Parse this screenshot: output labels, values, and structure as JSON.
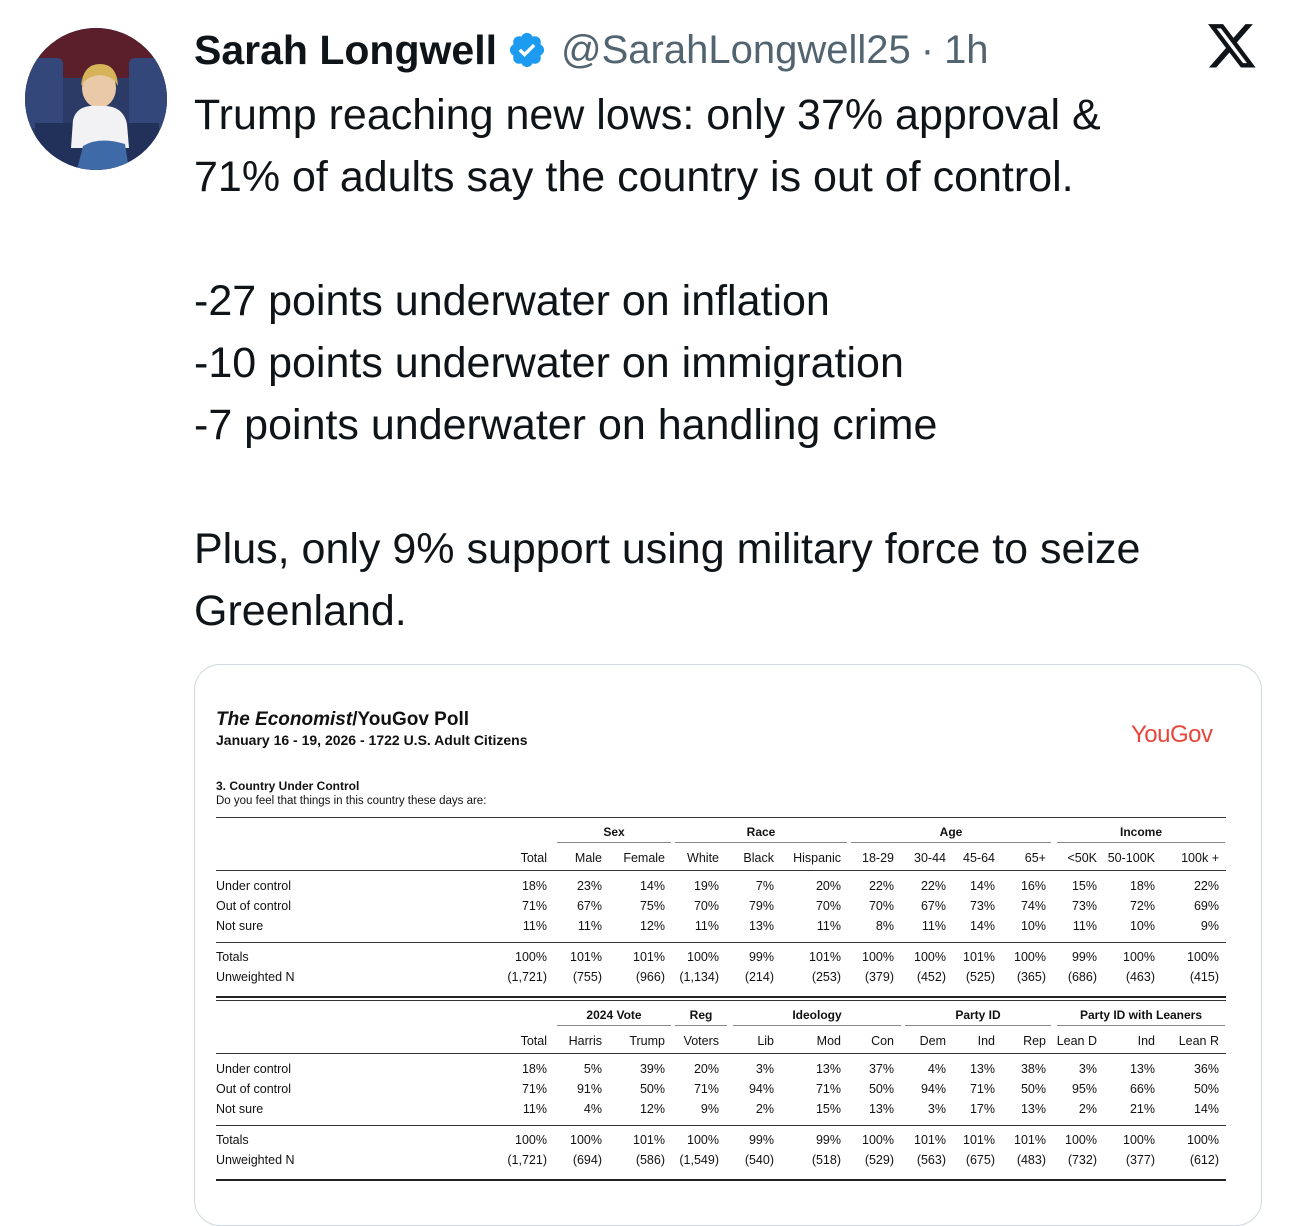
{
  "tweet": {
    "author_name": "Sarah Longwell",
    "handle": "@SarahLongwell25",
    "separator": "·",
    "time": "1h",
    "lines": [
      "Trump reaching new lows: only 37% approval &",
      "71% of adults say the country is out of control.",
      "",
      "-27 points underwater on inflation",
      "-10 points underwater on immigration",
      "-7 points underwater on handling crime",
      "",
      "Plus, only 9% support using military force to seize",
      "Greenland."
    ]
  },
  "colors": {
    "verified": "#1d9bf0",
    "yougov": "#e8453c",
    "handle": "#536471"
  },
  "icons": {
    "verified": "verified-badge-icon",
    "platform": "x-logo-icon"
  },
  "poll": {
    "title_italic": "The Economist",
    "title_rest": "/YouGov Poll",
    "subtitle": "January 16 - 19, 2026 - 1722 U.S. Adult Citizens",
    "brand": "YouGov",
    "question_title": "3. Country Under Control",
    "question_text": "Do you feel that things in this country these days are:",
    "table1": {
      "groups": [
        "Sex",
        "Race",
        "Age",
        "Income"
      ],
      "columns": [
        "Total",
        "Male",
        "Female",
        "White",
        "Black",
        "Hispanic",
        "18-29",
        "30-44",
        "45-64",
        "65+",
        "<50K",
        "50-100K",
        "100k +"
      ],
      "rows": [
        {
          "label": "Under control",
          "values": [
            "18%",
            "23%",
            "14%",
            "19%",
            "7%",
            "20%",
            "22%",
            "22%",
            "14%",
            "16%",
            "15%",
            "18%",
            "22%"
          ]
        },
        {
          "label": "Out of control",
          "values": [
            "71%",
            "67%",
            "75%",
            "70%",
            "79%",
            "70%",
            "70%",
            "67%",
            "73%",
            "74%",
            "73%",
            "72%",
            "69%"
          ]
        },
        {
          "label": "Not sure",
          "values": [
            "11%",
            "11%",
            "12%",
            "11%",
            "13%",
            "11%",
            "8%",
            "11%",
            "14%",
            "10%",
            "11%",
            "10%",
            "9%"
          ]
        }
      ],
      "totals": {
        "label": "Totals",
        "values": [
          "100%",
          "101%",
          "101%",
          "100%",
          "99%",
          "101%",
          "100%",
          "100%",
          "101%",
          "100%",
          "99%",
          "100%",
          "100%"
        ]
      },
      "unweighted": {
        "label": "Unweighted N",
        "values": [
          "(1,721)",
          "(755)",
          "(966)",
          "(1,134)",
          "(214)",
          "(253)",
          "(379)",
          "(452)",
          "(525)",
          "(365)",
          "(686)",
          "(463)",
          "(415)"
        ]
      }
    },
    "table2": {
      "groups": [
        "2024 Vote",
        "Reg",
        "Ideology",
        "Party ID",
        "Party ID with Leaners"
      ],
      "columns": [
        "Total",
        "Harris",
        "Trump",
        "Voters",
        "Lib",
        "Mod",
        "Con",
        "Dem",
        "Ind",
        "Rep",
        "Lean D",
        "Ind",
        "Lean R"
      ],
      "rows": [
        {
          "label": "Under control",
          "values": [
            "18%",
            "5%",
            "39%",
            "20%",
            "3%",
            "13%",
            "37%",
            "4%",
            "13%",
            "38%",
            "3%",
            "13%",
            "36%"
          ]
        },
        {
          "label": "Out of control",
          "values": [
            "71%",
            "91%",
            "50%",
            "71%",
            "94%",
            "71%",
            "50%",
            "94%",
            "71%",
            "50%",
            "95%",
            "66%",
            "50%"
          ]
        },
        {
          "label": "Not sure",
          "values": [
            "11%",
            "4%",
            "12%",
            "9%",
            "2%",
            "15%",
            "13%",
            "3%",
            "17%",
            "13%",
            "2%",
            "21%",
            "14%"
          ]
        }
      ],
      "totals": {
        "label": "Totals",
        "values": [
          "100%",
          "100%",
          "101%",
          "100%",
          "99%",
          "99%",
          "100%",
          "101%",
          "101%",
          "101%",
          "100%",
          "100%",
          "100%"
        ]
      },
      "unweighted": {
        "label": "Unweighted N",
        "values": [
          "(1,721)",
          "(694)",
          "(586)",
          "(1,549)",
          "(540)",
          "(518)",
          "(529)",
          "(563)",
          "(675)",
          "(483)",
          "(732)",
          "(377)",
          "(612)"
        ]
      }
    }
  }
}
